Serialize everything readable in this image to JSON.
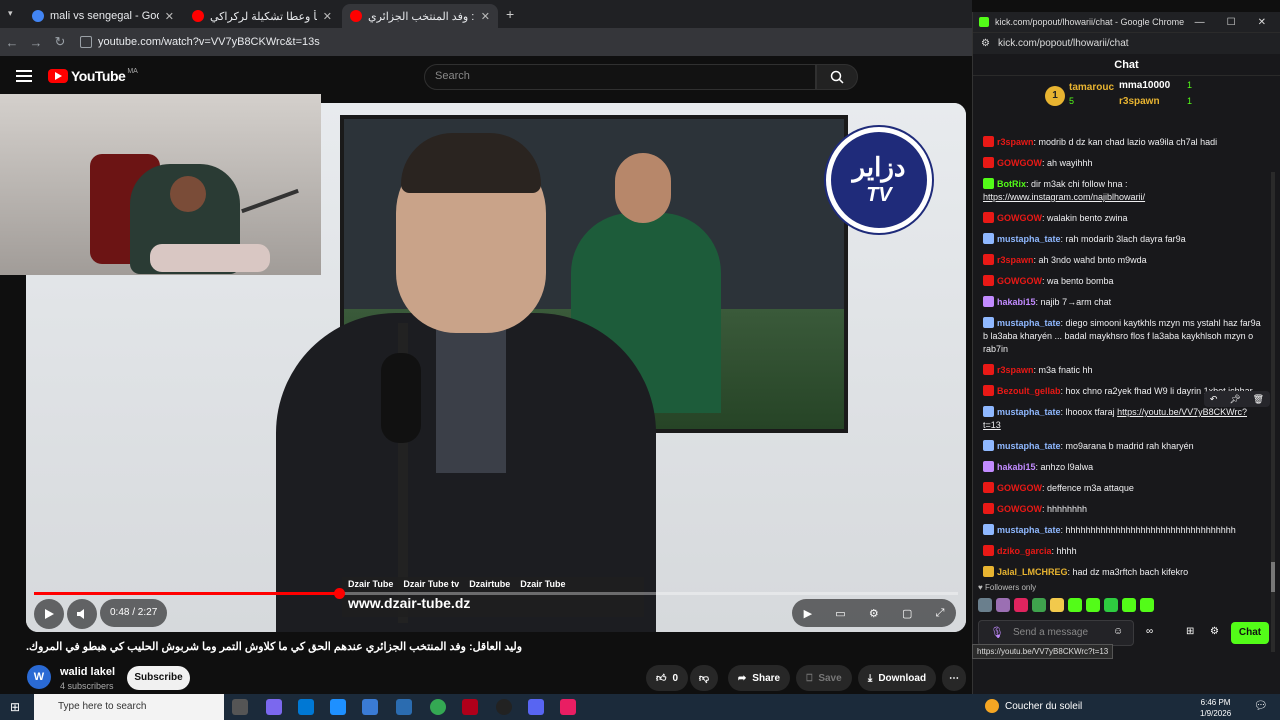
{
  "browser_left": {
    "tabs": [
      {
        "title": "mali vs sengegal - Google Sear",
        "icon_color": "#4285f4",
        "active": false
      },
      {
        "title": "بوزيوق يتنبأ وعطا تشكيلة لركراكي",
        "icon_color": "#ff0000",
        "active": false
      },
      {
        "title": "وليد العاقل: وفد المنتخب الجزائري",
        "icon_color": "#ff0000",
        "active": true
      }
    ],
    "new_tab": "+",
    "url": "youtube.com/watch?v=VV7yB8CKWrc&t=13s"
  },
  "youtube": {
    "logo_text": "YouTube",
    "country_code": "MA",
    "search_placeholder": "Search",
    "player": {
      "channel_badge_text": "TV",
      "channel_badge_arabic": "دزاير",
      "lower_third_socials": [
        "Dzair Tube",
        "Dzair Tube tv",
        "Dzairtube",
        "Dzair Tube"
      ],
      "lower_third_site": "www.dzair-tube.dz",
      "time": "0:48 / 2:27",
      "progress": 0.33
    },
    "video_title": "وليد العاقل: وفد المنتخب الجزائري عندهم الحق كي ما كلاوش التمر وما شربوش الحليب كي هبطو في المروك.",
    "channel": {
      "name": "walid lakel",
      "avatar_letter": "W",
      "subscribers": "4 subscribers",
      "subscribe_label": "Subscribe"
    },
    "actions": {
      "like_count": "0",
      "share": "Share",
      "save": "Save",
      "download": "Download"
    }
  },
  "chat_window": {
    "title": "kick.com/popout/lhowarii/chat - Google Chrome",
    "url": "kick.com/popout/lhowarii/chat",
    "header": "Chat",
    "leaderboard": [
      {
        "rank": "1",
        "name": "tamarouc",
        "count": "5"
      },
      {
        "name": "mma10000",
        "count": "1"
      },
      {
        "name": "r3spawn",
        "count": "1"
      }
    ],
    "messages": [
      {
        "user": "r3spawn",
        "color": "#e91916",
        "text": "modrib d dz kan chad lazio wa9ila ch7al hadi"
      },
      {
        "user": "GOWGOW",
        "color": "#e91916",
        "text": "ah wayihhh"
      },
      {
        "user": "BotRix",
        "color": "#53fc18",
        "text": "dir m3ak chi follow hna :",
        "link": "https://www.instagram.com/najiblhowarii/"
      },
      {
        "user": "GOWGOW",
        "color": "#e91916",
        "text": "walakin bento zwina"
      },
      {
        "user": "mustapha_tate",
        "color": "#8fb8ff",
        "text": "rah modarib 3lach dayra far9a"
      },
      {
        "user": "r3spawn",
        "color": "#e91916",
        "text": "ah 3ndo wahd bnto m9wda"
      },
      {
        "user": "GOWGOW",
        "color": "#e91916",
        "text": "wa bento bomba"
      },
      {
        "user": "hakabi15",
        "color": "#c28bff",
        "text": "najib 7→arm chat"
      },
      {
        "user": "mustapha_tate",
        "color": "#8fb8ff",
        "text": "diego simooni kaytkhls mzyn ms ystahl haz far9a b la3aba kharyén ... badal maykhsro flos f la3aba kaykhlsoh mzyn o rab7in"
      },
      {
        "user": "r3spawn",
        "color": "#e91916",
        "text": "m3a fnatic hh"
      },
      {
        "user": "Bezoult_gellab",
        "color": "#e91916",
        "text": "hox chno ra2yek fhad W9 li dayrin 1xbet ichhar"
      },
      {
        "user": "mustapha_tate",
        "color": "#8fb8ff",
        "text": "lhooox tfaraj",
        "link": "https://youtu.be/VV7yB8CKWrc?t=13"
      },
      {
        "user": "mustapha_tate",
        "color": "#8fb8ff",
        "text": "mo9arana b madrid rah kharyén"
      },
      {
        "user": "hakabi15",
        "color": "#c28bff",
        "text": "anhzo l9alwa"
      },
      {
        "user": "GOWGOW",
        "color": "#e91916",
        "text": "deffence m3a attaque"
      },
      {
        "user": "GOWGOW",
        "color": "#e91916",
        "text": "hhhhhhhh"
      },
      {
        "user": "mustapha_tate",
        "color": "#8fb8ff",
        "text": "hhhhhhhhhhhhhhhhhhhhhhhhhhhhhhhhhh"
      },
      {
        "user": "dziko_garcia",
        "color": "#e91916",
        "text": "hhhh"
      },
      {
        "user": "Jalal_LMCHREG",
        "color": "#e8b431",
        "text": "had dz ma3rftch bach kifekro"
      }
    ],
    "followers_only": "Followers only",
    "input_placeholder": "Send a message",
    "send_label": "Chat",
    "tooltip": "https://youtu.be/VV7yB8CKWrc?t=13"
  },
  "taskbar": {
    "search_placeholder": "Type here to search",
    "weather": "Coucher du soleil",
    "time": "6:46 PM",
    "date": "1/9/2026"
  }
}
